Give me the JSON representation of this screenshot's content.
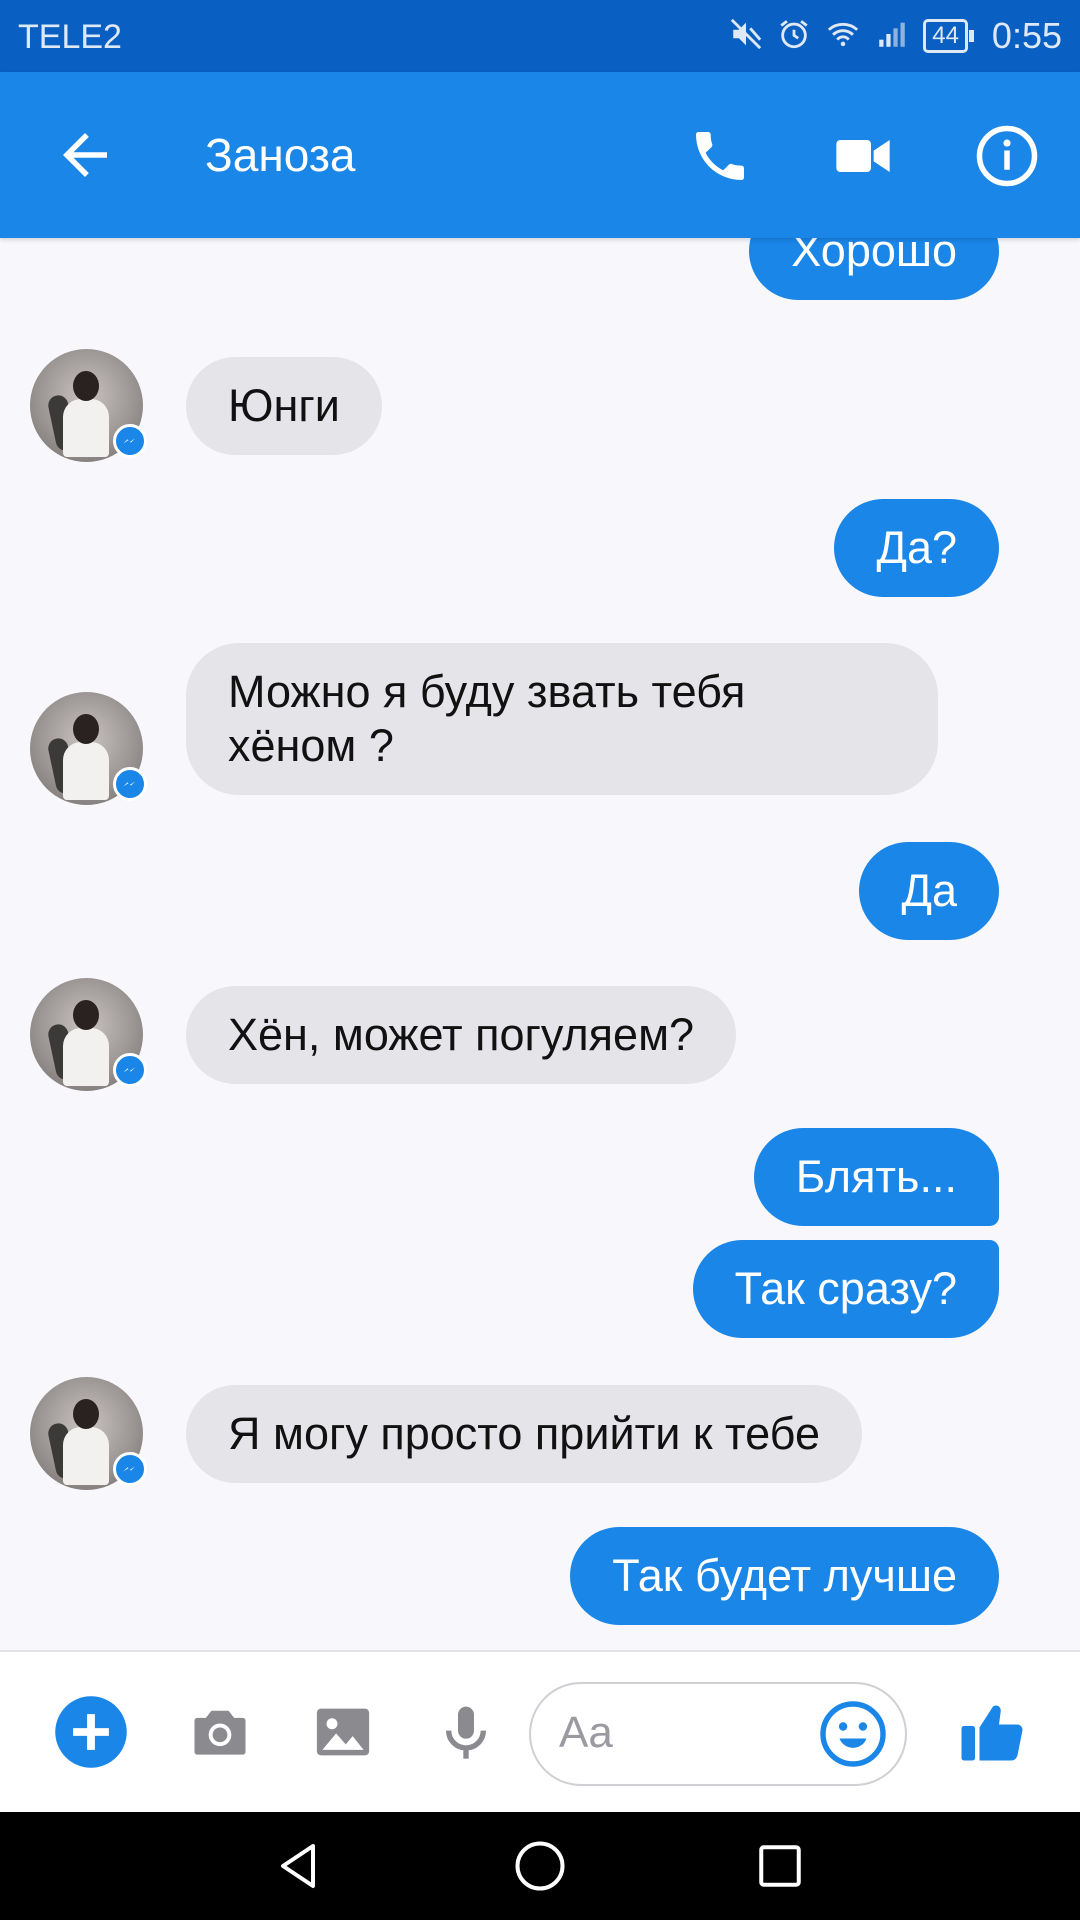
{
  "status_bar": {
    "carrier": "TELE2",
    "battery": "44",
    "time": "0:55",
    "icons": [
      "mute-icon",
      "alarm-icon",
      "wifi-icon",
      "signal-icon",
      "battery-icon"
    ]
  },
  "header": {
    "title": "Заноза",
    "icons": [
      "back-arrow-icon",
      "phone-icon",
      "video-camera-icon",
      "info-icon"
    ]
  },
  "messages": [
    {
      "from": "me",
      "text": "Хорошо"
    },
    {
      "from": "them",
      "text": "Юнги"
    },
    {
      "from": "me",
      "text": "Да?"
    },
    {
      "from": "them",
      "text": "Можно я буду звать тебя\nхёном ?"
    },
    {
      "from": "me",
      "text": "Да"
    },
    {
      "from": "them",
      "text": "Хён, может погуляем?"
    },
    {
      "from": "me",
      "text": "Блять..."
    },
    {
      "from": "me",
      "text": "Так сразу?"
    },
    {
      "from": "them",
      "text": "Я могу просто прийти к тебе"
    },
    {
      "from": "me",
      "text": "Так будет лучше"
    }
  ],
  "composer": {
    "placeholder": "Aa",
    "icons": [
      "plus-icon",
      "camera-icon",
      "image-icon",
      "microphone-icon",
      "emoji-icon",
      "thumbs-up-icon"
    ]
  },
  "navigation": {
    "icons": [
      "back-triangle-icon",
      "home-circle-icon",
      "recents-square-icon"
    ]
  },
  "colors": {
    "status_bar": "#0a5fc2",
    "header": "#1a86e8",
    "outgoing_bubble": "#1a86e8",
    "incoming_bubble": "#e5e4e9",
    "background": "#f8f7fb"
  }
}
